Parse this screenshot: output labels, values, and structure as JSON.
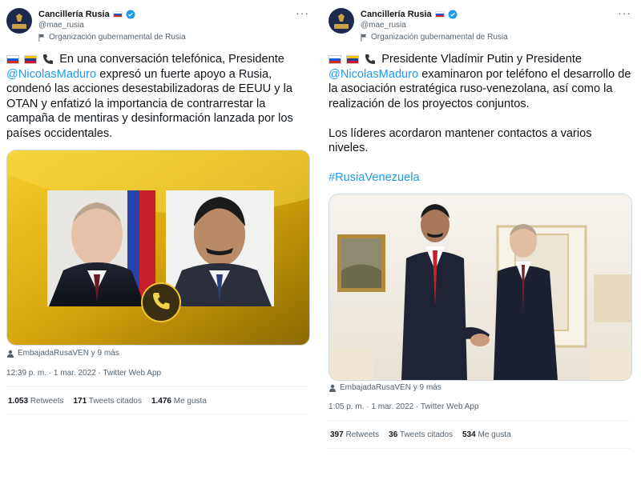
{
  "left": {
    "account_name": "Cancillería Rusia",
    "handle": "@mae_rusia",
    "org_label": "Organización gubernamental de Rusia",
    "more": "···",
    "text_a": "En una conversación telefónica, Presidente ",
    "mention": "@NicolasMaduro",
    "text_b": " expresó un fuerte apoyo a Rusia, condenó las acciones desestabilizadoras de EEUU y la OTAN y enfatizó la importancia de contrarrestar la campaña de mentiras y desinformación lanzada por los países occidentales.",
    "tagged": "EmbajadaRusaVEN y 9 más",
    "meta": "12:39 p. m. · 1 mar. 2022 · Twitter Web App",
    "retweets_count": "1.053",
    "retweets_label": "Retweets",
    "quotes_count": "171",
    "quotes_label": "Tweets citados",
    "likes_count": "1.476",
    "likes_label": "Me gusta"
  },
  "right": {
    "account_name": "Cancillería Rusia",
    "handle": "@mae_rusia",
    "org_label": "Organización gubernamental de Rusia",
    "more": "···",
    "text_a": "Presidente Vladímir Putin y Presidente ",
    "mention": "@NicolasMaduro",
    "text_b": " examinaron por teléfono el desarrollo de la asociación estratégica ruso-venezolana, así como la realización de los proyectos conjuntos.",
    "text_c": "Los líderes acordaron mantener contactos a varios niveles.",
    "hashtag": "#RusiaVenezuela",
    "tagged": "EmbajadaRusaVEN y 9 más",
    "meta": "1:05 p. m. · 1 mar. 2022 · Twitter Web App",
    "retweets_count": "397",
    "retweets_label": "Retweets",
    "quotes_count": "36",
    "quotes_label": "Tweets citados",
    "likes_count": "534",
    "likes_label": "Me gusta"
  },
  "colors": {
    "link": "#1d9bf0",
    "muted": "#536471",
    "text": "#0f1419",
    "verified": "#1d9bf0"
  },
  "icons": [
    "verified-badge-icon",
    "government-flag-icon",
    "more-icon",
    "person-icon",
    "phone-icon"
  ]
}
